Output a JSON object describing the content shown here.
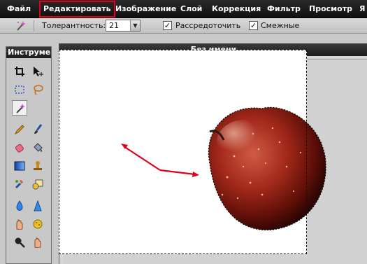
{
  "menu": {
    "items": [
      "Файл",
      "Редактировать",
      "Изображение",
      "Слой",
      "Коррекция",
      "Фильтр",
      "Просмотр",
      "Я"
    ],
    "highlighted_item": "Редактировать",
    "highlight_color": "#e0001b"
  },
  "options": {
    "tolerance_label": "Толерантность:",
    "tolerance_value": "21",
    "antialias_label": "Рассредоточить",
    "antialias_checked": true,
    "contiguous_label": "Смежные",
    "contiguous_checked": true,
    "check_mark": "✓",
    "active_tool_icon": "magic-wand-icon"
  },
  "tools_panel": {
    "title": "Инструменты",
    "tools": [
      "crop-icon",
      "move-icon",
      "rect-select-icon",
      "lasso-icon",
      "magic-wand-icon",
      "pencil-icon",
      "brush-icon",
      "eraser-icon",
      "paint-bucket-icon",
      "gradient-icon",
      "stamp-icon",
      "color-replace-icon",
      "drawing-icon",
      "blur-icon",
      "sharpen-icon",
      "smudge-icon",
      "sponge-icon",
      "dodge-icon",
      "burn-icon"
    ],
    "active_tool": "magic-wand-icon"
  },
  "document": {
    "title": "Без имени",
    "canvas_color": "#ffffff",
    "selection_style": "marching-ants",
    "annotation_arrow_color": "#e0001b",
    "subject_icon": "apple-icon"
  }
}
